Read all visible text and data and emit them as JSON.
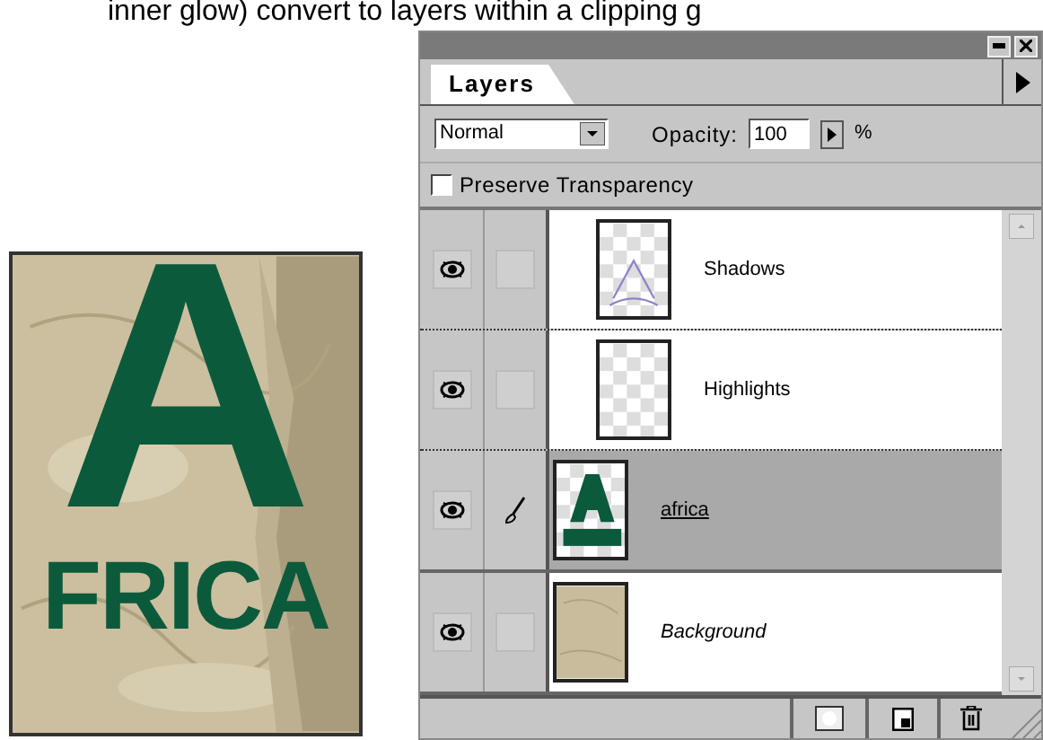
{
  "caption": "inner glow) convert to layers within a clipping g",
  "artwork": {
    "letter": "A",
    "word": "FRICA"
  },
  "panel": {
    "tab": {
      "label": "Layers",
      "selected": true
    },
    "blend_mode": "Normal",
    "opacity_label": "Opacity:",
    "opacity": "100",
    "percent": "%",
    "preserve_transparency": {
      "label": "Preserve Transparency",
      "checked": false
    },
    "layers": [
      {
        "name": "Shadows",
        "kind": "layer",
        "thumbnail": {
          "kind": "sketch"
        },
        "visible": true,
        "paint": false,
        "clipped": true,
        "selected": false
      },
      {
        "name": "Highlights",
        "kind": "layer",
        "thumbnail": {
          "kind": "empty"
        },
        "visible": true,
        "paint": false,
        "clipped": true,
        "selected": false
      },
      {
        "name": "africa",
        "kind": "layer",
        "thumbnail": {
          "kind": "art"
        },
        "visible": true,
        "paint": true,
        "clipped": false,
        "selected": true
      },
      {
        "name": "Background",
        "kind": "background",
        "thumbnail": {
          "kind": "texture"
        },
        "visible": true,
        "paint": false,
        "clipped": false,
        "selected": false
      }
    ]
  }
}
